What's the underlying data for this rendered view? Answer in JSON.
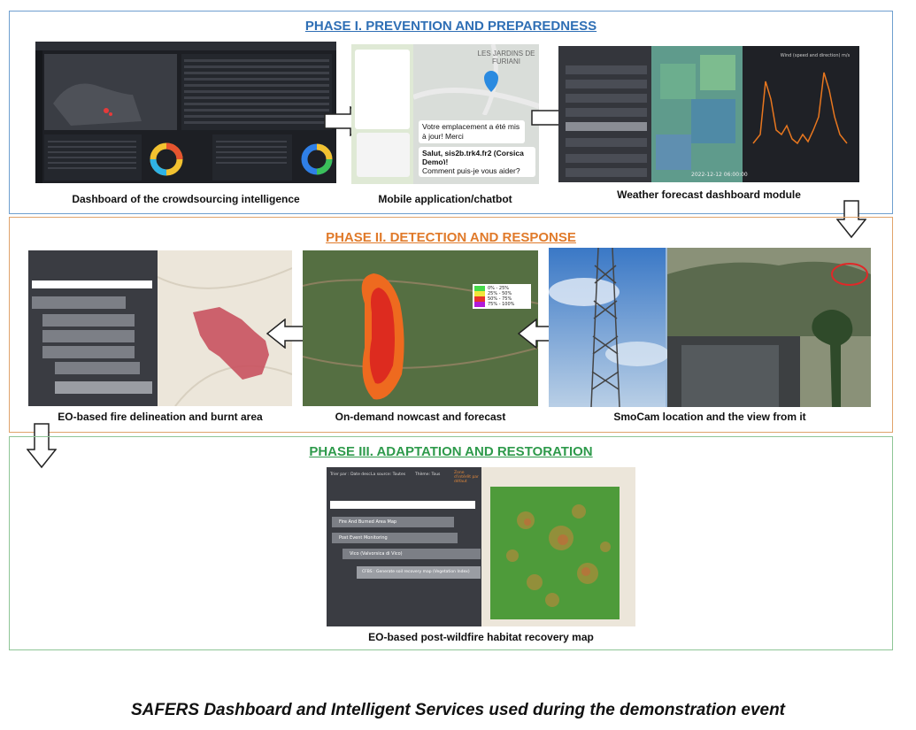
{
  "phases": [
    {
      "title": "PHASE I. PREVENTION AND PREPAREDNESS",
      "color": "#2f6fb5",
      "border": "#6e9fcf",
      "captions": [
        "Dashboard of the crowdsourcing intelligence",
        "Mobile application/chatbot",
        "Weather forecast dashboard module"
      ]
    },
    {
      "title": "PHASE II. DETECTION AND RESPONSE",
      "color": "#e07a2a",
      "border": "#e0a36b",
      "captions": [
        "EO-based fire delineation and burnt area",
        "On-demand nowcast and forecast",
        "SmoCam location and the view from it"
      ]
    },
    {
      "title": "PHASE III. ADAPTATION AND RESTORATION",
      "color": "#2e9a4b",
      "border": "#8ec596",
      "captions": [
        "EO-based post-wildfire habitat recovery map"
      ]
    }
  ],
  "chat": {
    "map_label": "LES JARDINS DE FURIANI",
    "msg1": "Votre emplacement a été mis à jour! Merci",
    "msg2": "Salut, sis2b.trk4.fr2 (Corsica Demo)!",
    "msg3": "Comment puis-je vous aider?"
  },
  "weather": {
    "chart_title": "Wind (speed and direction) m/s",
    "timestamp": "2022-12-12 06:00:00"
  },
  "nowcast_legend": [
    {
      "label": "0% - 25%",
      "color": "#46d94a"
    },
    {
      "label": "25% - 50%",
      "color": "#f2e53a"
    },
    {
      "label": "50% - 75%",
      "color": "#e8332b"
    },
    {
      "label": "75% - 100%",
      "color": "#b11ad8"
    }
  ],
  "restoration_panel": {
    "filters": [
      "Trier par : Date desc",
      "La source: Toutes",
      "Thème: Tous"
    ],
    "zoom_note": "Zone d'intérêt par défaut",
    "items": [
      "Fire And Burned Area Map",
      "Post Event Monitoring",
      "Vico (Valvorsica di Vico)",
      "CFBS : Generate soil recovery map (Vegetation Index)"
    ]
  },
  "footer": "SAFERS Dashboard and Intelligent Services used during the demonstration event"
}
